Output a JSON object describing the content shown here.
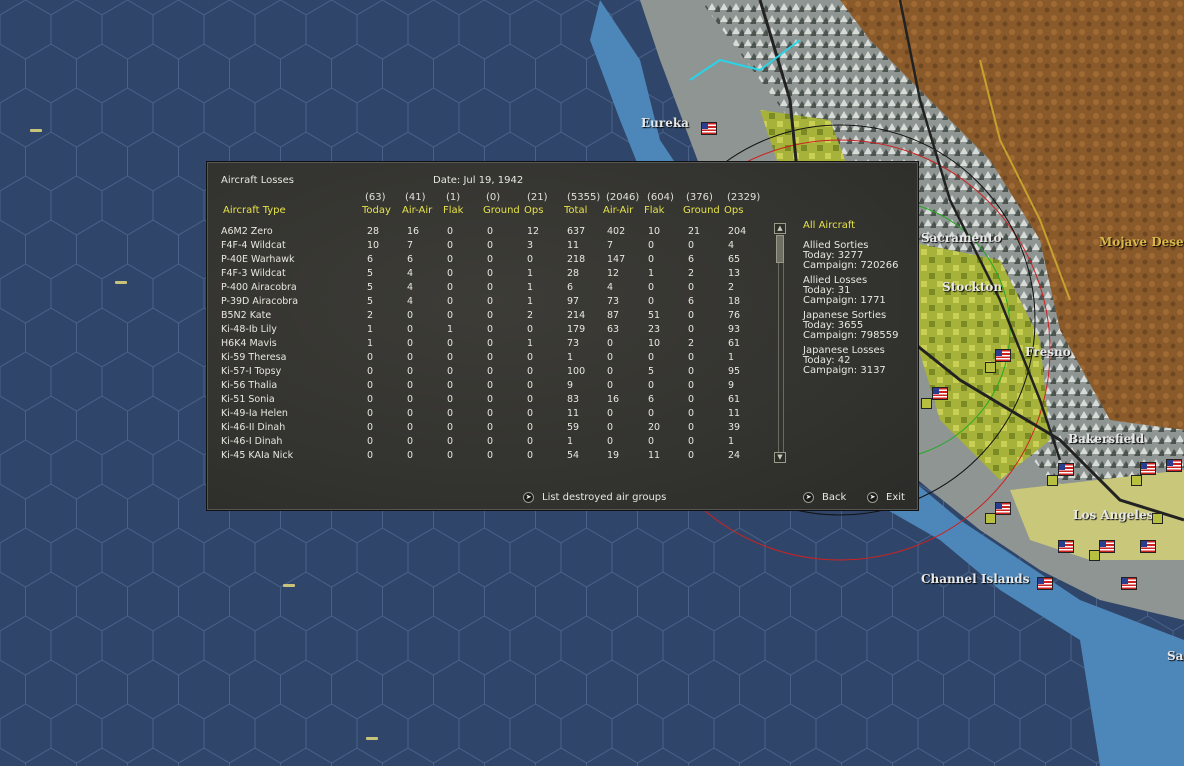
{
  "map": {
    "labels": [
      "Eureka",
      "Sacramento",
      "Stockton",
      "Fresno",
      "Mojave Desert",
      "Bakersfield",
      "Los Angeles",
      "Channel Islands",
      "Sa"
    ]
  },
  "dialog": {
    "title": "Aircraft Losses",
    "date": "Date: Jul 19, 1942",
    "headers": {
      "today_totals": [
        "(63)",
        "(41)",
        "(1)",
        "(0)",
        "(21)"
      ],
      "campaign_totals": [
        "(5355)",
        "(2046)",
        "(604)",
        "(376)",
        "(2329)"
      ],
      "aircraft_type": "Aircraft Type",
      "today_labels": [
        "Today",
        "Air-Air",
        "Flak",
        "Ground",
        "Ops"
      ],
      "campaign_labels": [
        "Total",
        "Air-Air",
        "Flak",
        "Ground",
        "Ops"
      ]
    },
    "rows": [
      {
        "name": "A6M2 Zero",
        "v": [
          "28",
          "16",
          "0",
          "0",
          "12",
          "637",
          "402",
          "10",
          "21",
          "204"
        ]
      },
      {
        "name": "F4F-4 Wildcat",
        "v": [
          "10",
          "7",
          "0",
          "0",
          "3",
          "11",
          "7",
          "0",
          "0",
          "4"
        ]
      },
      {
        "name": "P-40E Warhawk",
        "v": [
          "6",
          "6",
          "0",
          "0",
          "0",
          "218",
          "147",
          "0",
          "6",
          "65"
        ]
      },
      {
        "name": "F4F-3 Wildcat",
        "v": [
          "5",
          "4",
          "0",
          "0",
          "1",
          "28",
          "12",
          "1",
          "2",
          "13"
        ]
      },
      {
        "name": "P-400 Airacobra",
        "v": [
          "5",
          "4",
          "0",
          "0",
          "1",
          "6",
          "4",
          "0",
          "0",
          "2"
        ]
      },
      {
        "name": "P-39D Airacobra",
        "v": [
          "5",
          "4",
          "0",
          "0",
          "1",
          "97",
          "73",
          "0",
          "6",
          "18"
        ]
      },
      {
        "name": "B5N2 Kate",
        "v": [
          "2",
          "0",
          "0",
          "0",
          "2",
          "214",
          "87",
          "51",
          "0",
          "76"
        ]
      },
      {
        "name": "Ki-48-Ib Lily",
        "v": [
          "1",
          "0",
          "1",
          "0",
          "0",
          "179",
          "63",
          "23",
          "0",
          "93"
        ]
      },
      {
        "name": "H6K4 Mavis",
        "v": [
          "1",
          "0",
          "0",
          "0",
          "1",
          "73",
          "0",
          "10",
          "2",
          "61"
        ]
      },
      {
        "name": "Ki-59 Theresa",
        "v": [
          "0",
          "0",
          "0",
          "0",
          "0",
          "1",
          "0",
          "0",
          "0",
          "1"
        ]
      },
      {
        "name": "Ki-57-I Topsy",
        "v": [
          "0",
          "0",
          "0",
          "0",
          "0",
          "100",
          "0",
          "5",
          "0",
          "95"
        ]
      },
      {
        "name": "Ki-56 Thalia",
        "v": [
          "0",
          "0",
          "0",
          "0",
          "0",
          "9",
          "0",
          "0",
          "0",
          "9"
        ]
      },
      {
        "name": "Ki-51 Sonia",
        "v": [
          "0",
          "0",
          "0",
          "0",
          "0",
          "83",
          "16",
          "6",
          "0",
          "61"
        ]
      },
      {
        "name": "Ki-49-Ia Helen",
        "v": [
          "0",
          "0",
          "0",
          "0",
          "0",
          "11",
          "0",
          "0",
          "0",
          "11"
        ]
      },
      {
        "name": "Ki-46-II Dinah",
        "v": [
          "0",
          "0",
          "0",
          "0",
          "0",
          "59",
          "0",
          "20",
          "0",
          "39"
        ]
      },
      {
        "name": "Ki-46-I Dinah",
        "v": [
          "0",
          "0",
          "0",
          "0",
          "0",
          "1",
          "0",
          "0",
          "0",
          "1"
        ]
      },
      {
        "name": "Ki-45 KAIa Nick",
        "v": [
          "0",
          "0",
          "0",
          "0",
          "0",
          "54",
          "19",
          "11",
          "0",
          "24"
        ]
      }
    ],
    "summary": {
      "filter": "All Aircraft",
      "allied_sorties": {
        "title": "Allied Sorties",
        "today": "Today:  3277",
        "campaign": "Campaign: 720266"
      },
      "allied_losses": {
        "title": "Allied Losses",
        "today": "Today:  31",
        "campaign": "Campaign: 1771"
      },
      "japanese_sorties": {
        "title": "Japanese Sorties",
        "today": "Today:  3655",
        "campaign": "Campaign: 798559"
      },
      "japanese_losses": {
        "title": "Japanese Losses",
        "today": "Today:  42",
        "campaign": "Campaign: 3137"
      }
    },
    "buttons": {
      "list_destroyed": "List destroyed air groups",
      "back": "Back",
      "exit": "Exit"
    },
    "icons": {
      "arrow": "arrow-right-icon",
      "scroll_up": "scroll-up-icon",
      "scroll_down": "scroll-down-icon"
    }
  }
}
